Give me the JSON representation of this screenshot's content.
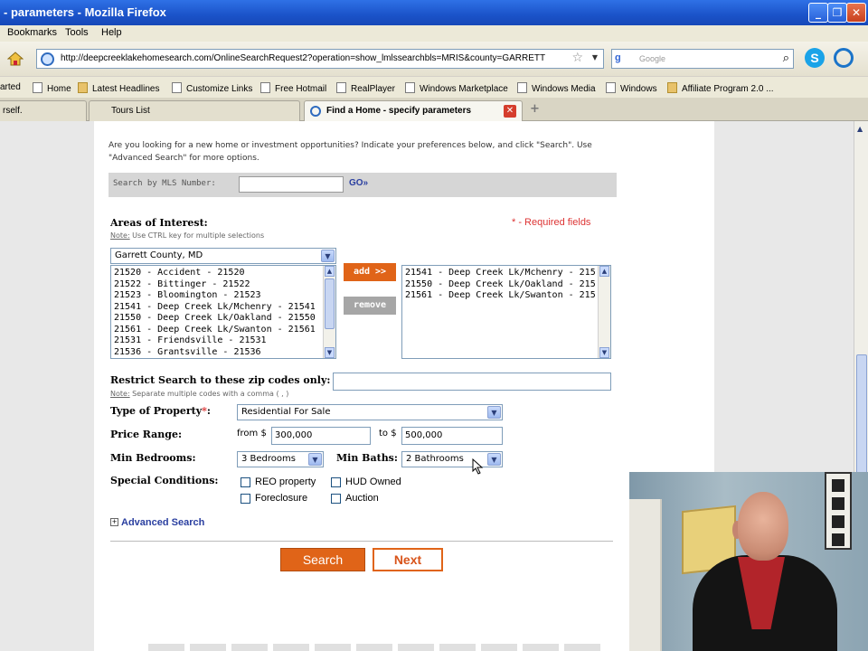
{
  "window": {
    "title": "- parameters - Mozilla Firefox"
  },
  "menu": {
    "items": [
      "Bookmarks",
      "Tools",
      "Help"
    ]
  },
  "toolbar": {
    "url": "http://deepcreeklakehomesearch.com/OnlineSearchRequest2?operation=show_lmlssearchbls=MRIS&county=GARRETT",
    "search_placeholder": "Google"
  },
  "bookmarks": [
    {
      "label": "arted",
      "icon": "page"
    },
    {
      "label": "Home",
      "icon": "page"
    },
    {
      "label": "Latest Headlines",
      "icon": "folder"
    },
    {
      "label": "Customize Links",
      "icon": "page"
    },
    {
      "label": "Free Hotmail",
      "icon": "page"
    },
    {
      "label": "RealPlayer",
      "icon": "page"
    },
    {
      "label": "Windows Marketplace",
      "icon": "page"
    },
    {
      "label": "Windows Media",
      "icon": "page"
    },
    {
      "label": "Windows",
      "icon": "page"
    },
    {
      "label": "Affiliate Program 2.0 ...",
      "icon": "folder"
    }
  ],
  "tabs": [
    {
      "label": "rself."
    },
    {
      "label": "Tours List"
    },
    {
      "label": "Find a Home - specify parameters",
      "active": true
    }
  ],
  "form": {
    "intro": "Are you looking for a new home or investment opportunities? Indicate your preferences below, and click \"Search\". Use \"Advanced Search\" for more options.",
    "mls_label": "Search by MLS Number:",
    "mls_value": "",
    "go_label": "GO»",
    "areas_title": "Areas of Interest:",
    "areas_note_prefix": "Note:",
    "areas_note": " Use CTRL key for multiple selections",
    "required": "* - Required fields",
    "county": "Garrett County, MD",
    "available_zips": [
      "21520 - Accident - 21520",
      "21522 - Bittinger - 21522",
      "21523 - Bloomington - 21523",
      "21541 - Deep Creek Lk/Mchenry - 21541",
      "21550 - Deep Creek Lk/Oakland - 21550",
      "21561 - Deep Creek Lk/Swanton - 21561",
      "21531 - Friendsville - 21531",
      "21536 - Grantsville - 21536"
    ],
    "selected_zips": [
      "21541 - Deep Creek Lk/Mchenry - 215",
      "21550 - Deep Creek Lk/Oakland - 215",
      "21561 - Deep Creek Lk/Swanton - 215"
    ],
    "add_label": "add >>",
    "remove_label": "remove",
    "restrict_label": "Restrict Search to these zip codes only:",
    "restrict_value": "",
    "restrict_note_prefix": "Note:",
    "restrict_note": " Separate multiple codes with a comma ( , )",
    "type_label": "Type of Property",
    "type_star": "*",
    "type_colon": ":",
    "type_value": "Residential For Sale",
    "price_label": "Price Range:",
    "from_label": "from $",
    "price_from": "300,000",
    "to_label": "to $",
    "price_to": "500,000",
    "beds_label": "Min Bedrooms:",
    "beds_value": "3 Bedrooms",
    "baths_label": "Min Baths:",
    "baths_value": "2 Bathrooms",
    "special_label": "Special Conditions:",
    "conditions": [
      "REO property",
      "HUD Owned",
      "Foreclosure",
      "Auction"
    ],
    "advanced_label": "Advanced Search",
    "search_label": "Search",
    "next_label": "Next"
  },
  "colors": {
    "accent": "#e06418",
    "link": "#2a3fa0",
    "required": "#dd3333"
  }
}
